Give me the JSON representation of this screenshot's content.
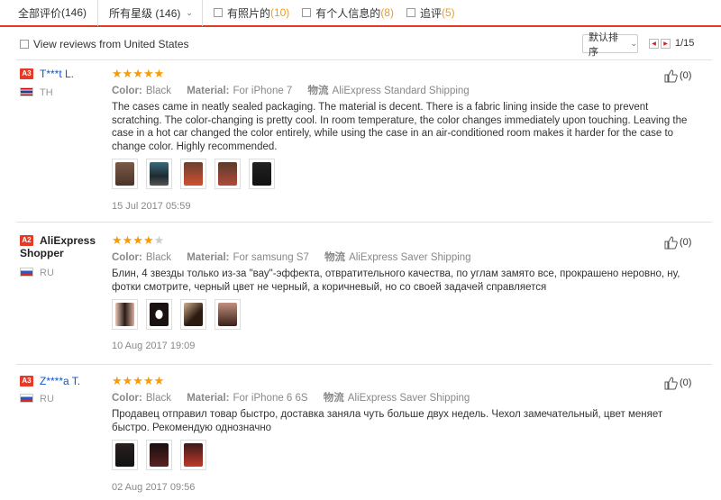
{
  "topbar": {
    "all_label": "全部评价",
    "all_count": "(146)",
    "stars_select": "所有星级 (146)",
    "with_photos_label": "有照片的",
    "with_photos_count": "(10)",
    "with_info_label": "有个人信息的",
    "with_info_count": "(8)",
    "followup_label": "追评",
    "followup_count": "(5)"
  },
  "filter": {
    "us_label": "View reviews from United States",
    "sort_label": "默认排序",
    "page_info": "1/15"
  },
  "reviews": [
    {
      "badge": "A3",
      "name": "T***t L.",
      "country": "TH",
      "stars": "★★★★★",
      "stars_off": "",
      "color_label": "Color:",
      "color_value": "Black",
      "material_label": "Material:",
      "material_value": "For iPhone 7",
      "shipping_label": "物流",
      "shipping_value": "AliExpress Standard Shipping",
      "text": "The cases came in neatly sealed packaging. The material is decent. There is a fabric lining inside the case to prevent scratching. The color-changing is pretty cool. In room temperature, the color changes immediately upon touching. Leaving the case in a hot car changed the color entirely, while using the case in an air-conditioned room makes it harder for the case to change color. Highly recommended.",
      "date": "15 Jul 2017 05:59",
      "likes": "(0)"
    },
    {
      "badge": "A2",
      "name": "AliExpress Shopper",
      "country": "RU",
      "stars": "★★★★",
      "stars_off": "★",
      "color_label": "Color:",
      "color_value": "Black",
      "material_label": "Material:",
      "material_value": "For samsung S7",
      "shipping_label": "物流",
      "shipping_value": "AliExpress Saver Shipping",
      "text": "Блин, 4 звезды только из-за \"вау\"-эффекта, отвратительного качества, по углам замято все, прокрашено неровно, ну, фотки смотрите, черный цвет не черный, а коричневый, но со своей задачей справляется",
      "date": "10 Aug 2017 19:09",
      "likes": "(0)"
    },
    {
      "badge": "A3",
      "name": "Z****a T.",
      "country": "RU",
      "stars": "★★★★★",
      "stars_off": "",
      "color_label": "Color:",
      "color_value": "Black",
      "material_label": "Material:",
      "material_value": "For iPhone 6 6S",
      "shipping_label": "物流",
      "shipping_value": "AliExpress Saver Shipping",
      "text": "Продавец отправил товар быстро, доставка заняла чуть больше двух недель. Чехол замечательный, цвет меняет быстро. Рекомендую однозначно",
      "date": "02 Aug 2017 09:56",
      "likes": "(0)"
    }
  ],
  "colors": {
    "accent": "#e53a27",
    "count": "#ff9900",
    "star": "#f79b06",
    "link": "#1155cc"
  }
}
